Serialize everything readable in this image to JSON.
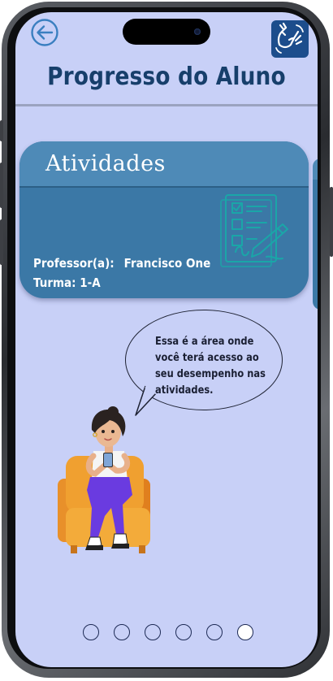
{
  "header": {
    "title": "Progresso do Aluno",
    "back_icon": "arrow-left-circle-icon",
    "accessibility_icon": "sign-language-icon"
  },
  "card": {
    "title": "Atividades",
    "icon": "activity-checklist-icon",
    "teacher_label": "Professor(a):",
    "teacher_name": "Francisco One",
    "class_text": "Turma: 1-A"
  },
  "assistant": {
    "message": "Essa é a área onde você terá acesso ao seu desempenho nas atividades.",
    "avatar": "student-on-armchair-illustration"
  },
  "pagination": {
    "total": 6,
    "active_index": 6
  },
  "colors": {
    "background": "#c8d0f7",
    "title": "#173f6b",
    "card": "#3b78a6",
    "card_header": "#4e8ab7",
    "accent": "#1c4d8c"
  }
}
